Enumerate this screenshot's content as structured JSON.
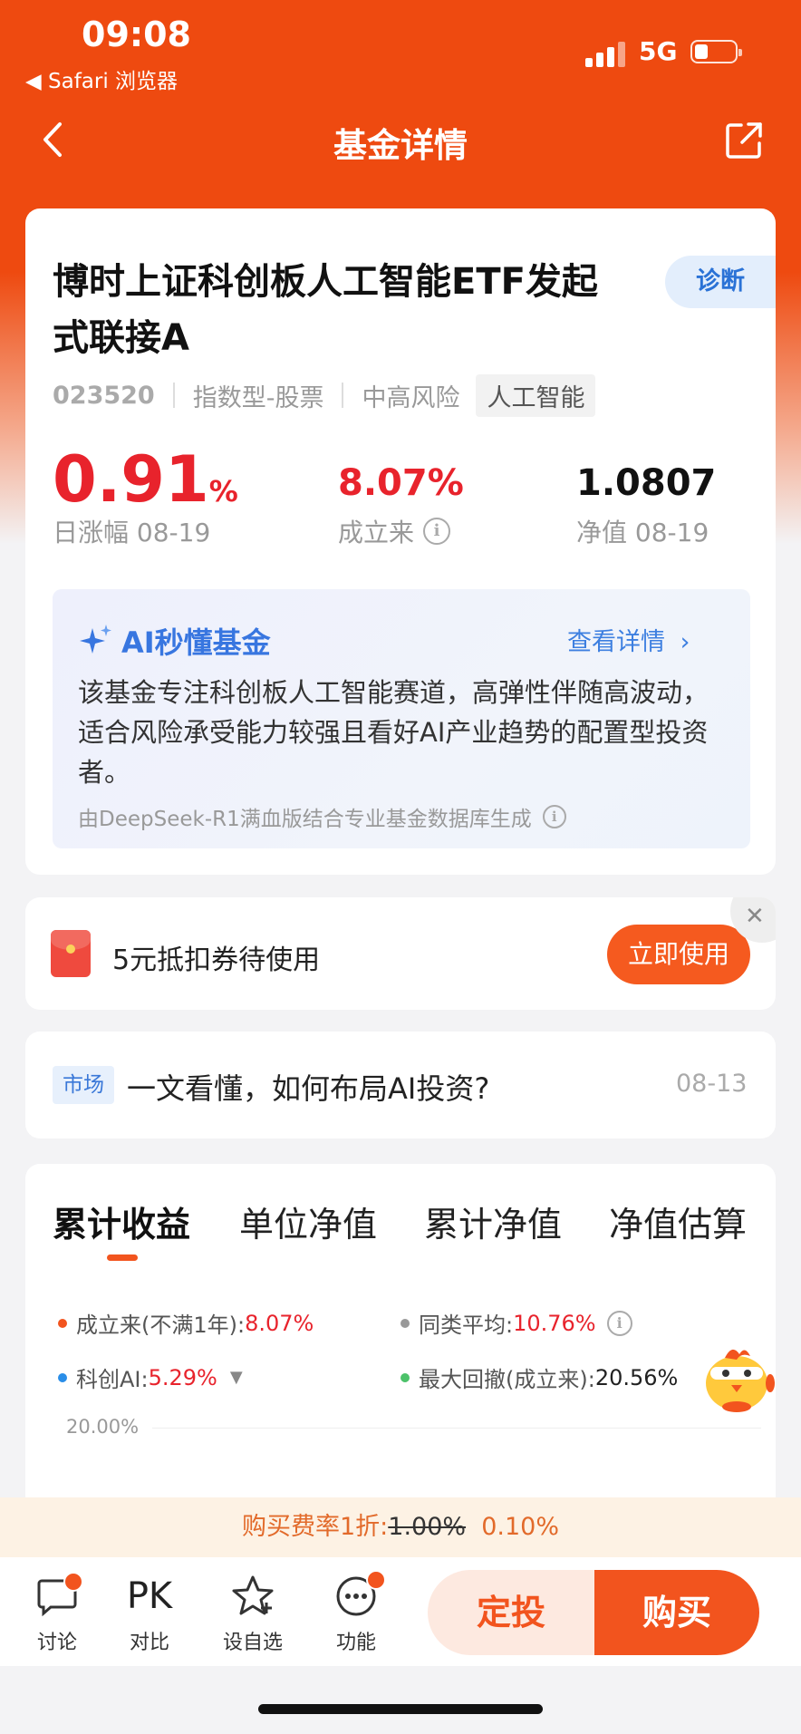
{
  "status_bar": {
    "time": "09:08",
    "back_app": "◀ Safari 浏览器",
    "network": "5G"
  },
  "nav": {
    "title": "基金详情"
  },
  "fund": {
    "name": "博时上证科创板人工智能ETF发起式联接A",
    "diagnose_label": "诊断",
    "code": "023520",
    "type": "指数型-股票",
    "risk": "中高风险",
    "theme_tag": "人工智能",
    "daily_change_value": "0.91",
    "daily_change_unit": "%",
    "daily_change_label": "日涨幅 08-19",
    "since_inception_value": "8.07%",
    "since_inception_label": "成立来",
    "nav_value": "1.0807",
    "nav_label": "净值 08-19"
  },
  "ai_summary": {
    "title": "AI秒懂基金",
    "more_label": "查看详情",
    "text": "该基金专注科创板人工智能赛道，高弹性伴随高波动，适合风险承受能力较强且看好AI产业趋势的配置型投资者。",
    "footer": "由DeepSeek-R1满血版结合专业基金数据库生成"
  },
  "coupon": {
    "text": "5元抵扣券待使用",
    "button": "立即使用",
    "close": "✕"
  },
  "news": {
    "tag": "市场",
    "title": "一文看懂，如何布局AI投资?",
    "date": "08-13"
  },
  "chart_tabs": {
    "tabs": [
      "累计收益",
      "单位净值",
      "累计净值",
      "净值估算"
    ],
    "active_index": 0
  },
  "chart_data": {
    "type": "line",
    "title": "",
    "legend": [
      {
        "label": "成立来(不满1年):",
        "value": "8.07%",
        "color": "#f2541e"
      },
      {
        "label": "同类平均:",
        "value": "10.76%",
        "color": "#999999"
      },
      {
        "label": "科创AI:",
        "value": "5.29%",
        "color": "#2a8ee8"
      },
      {
        "label": "最大回撤(成立来):",
        "value": "20.56%",
        "color": "#4cc26a"
      }
    ],
    "y_ticks": [
      "20.00%"
    ],
    "series": []
  },
  "fee_banner": {
    "prefix": "购买费率1折:",
    "original": "1.00%",
    "discounted": "0.10%"
  },
  "bottom_bar": {
    "discuss": "讨论",
    "compare_icon_text": "PK",
    "compare": "对比",
    "watchlist": "设自选",
    "functions": "功能",
    "sip_button": "定投",
    "buy_button": "购买"
  },
  "colors": {
    "brand": "#ee4a10",
    "rise": "#e8232c",
    "accent_blue": "#3876e0"
  }
}
